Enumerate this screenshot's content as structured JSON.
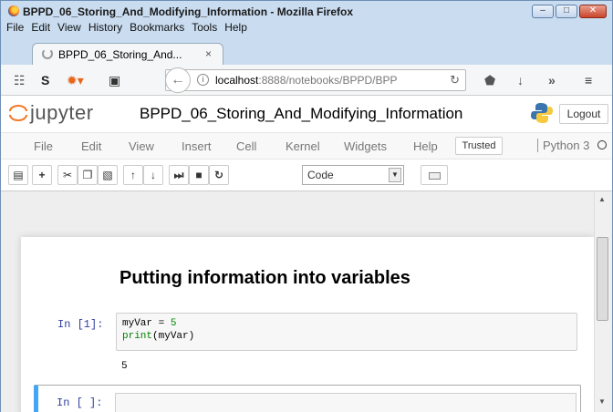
{
  "window": {
    "title": "BPPD_06_Storing_And_Modifying_Information - Mozilla Firefox",
    "minimize": "–",
    "maximize": "□",
    "close": "✕"
  },
  "browser_menu": [
    "File",
    "Edit",
    "View",
    "History",
    "Bookmarks",
    "Tools",
    "Help"
  ],
  "tab": {
    "title": "BPPD_06_Storing_And...",
    "close": "×"
  },
  "nav": {
    "url_host": "localhost",
    "url_rest": ":8888/notebooks/BPPD/BPP",
    "icons": [
      "rss-icon",
      "s-icon",
      "bug-icon",
      "save-icon",
      "back-icon",
      "reload-icon",
      "pocket-icon",
      "download-icon",
      "overflow-icon",
      "hamburger-icon"
    ]
  },
  "jupyter": {
    "brand": "jupyter",
    "notebook_title": "BPPD_06_Storing_And_Modifying_Information",
    "logout": "Logout",
    "menu": [
      "File",
      "Edit",
      "View",
      "Insert",
      "Cell",
      "Kernel",
      "Widgets",
      "Help"
    ],
    "trusted": "Trusted",
    "kernel": "Python 3",
    "cell_type": "Code"
  },
  "notebook": {
    "heading": "Putting information into variables",
    "cell1": {
      "prompt": "In [1]:",
      "line1_var": "myVar = ",
      "line1_val": "5",
      "line2_fn": "print",
      "line2_arg": "(myVar)",
      "output": "5"
    },
    "cell2": {
      "prompt": "In [ ]:"
    }
  },
  "colors": {
    "active_cell_bar": "#42a5f5",
    "prompt_color": "#303f9f"
  }
}
